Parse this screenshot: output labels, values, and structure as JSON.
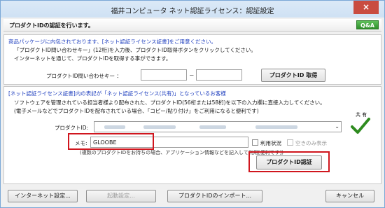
{
  "window": {
    "title": "福井コンピュータ ネット認証ライセンス：認証設定",
    "close_glyph": "×"
  },
  "header": {
    "text": "プロダクトIDの認証を行います。",
    "qa_label": "Q&A"
  },
  "section1": {
    "heading": "商品パッケージに内包されております、[ネット認証ライセンス証書]をご用意ください。",
    "line1": "「プロダクトID問い合わせキー」(12桁)を入力後、プロダクトID取得ボタンをクリックしてください。",
    "line2": "インターネットを通じて、プロダクトIDを取得する事ができます。",
    "inquiry_label": "プロダクトID問い合わせキー ：",
    "inquiry_value1": "",
    "inquiry_separator": "－",
    "inquiry_value2": "",
    "get_button": "プロダクトID 取得"
  },
  "section2": {
    "heading": "[ネット認証ライセンス証書]内の表記が「ネット認証ライセンス(共有)」となっているお客様",
    "line1": "ソフトウェアを管理されている担当者様より配布された、プロダクトID(56桁または58桁)を以下の入力欄に直接入力してください。",
    "line2": "(電子メールなどでプロダクトIDを配布されている場合、「コピー/貼り付け」をご利用になると便利です)",
    "product_id_label": "プロダクトID:",
    "shared_label": "共 有",
    "memo_label": "メモ:",
    "memo_value": "GLOOBE",
    "usage_checkbox": "利用状況",
    "free_only_checkbox": "空きのみ表示",
    "note": "(複数のプロダクトIDをお持ちの場合、アプリケーション情報などを記入して利用[便利です])",
    "auth_button": "プロダクトID認証"
  },
  "footer": {
    "internet_settings": "インターネット設定...",
    "startup_settings": "起動設定...",
    "import_button": "プロダクトIDのインポート...",
    "cancel_button": "キャンセル"
  },
  "colors": {
    "accent_red": "#d0161e",
    "link_blue": "#1f3fbf",
    "check_green": "#2e8b1f"
  }
}
